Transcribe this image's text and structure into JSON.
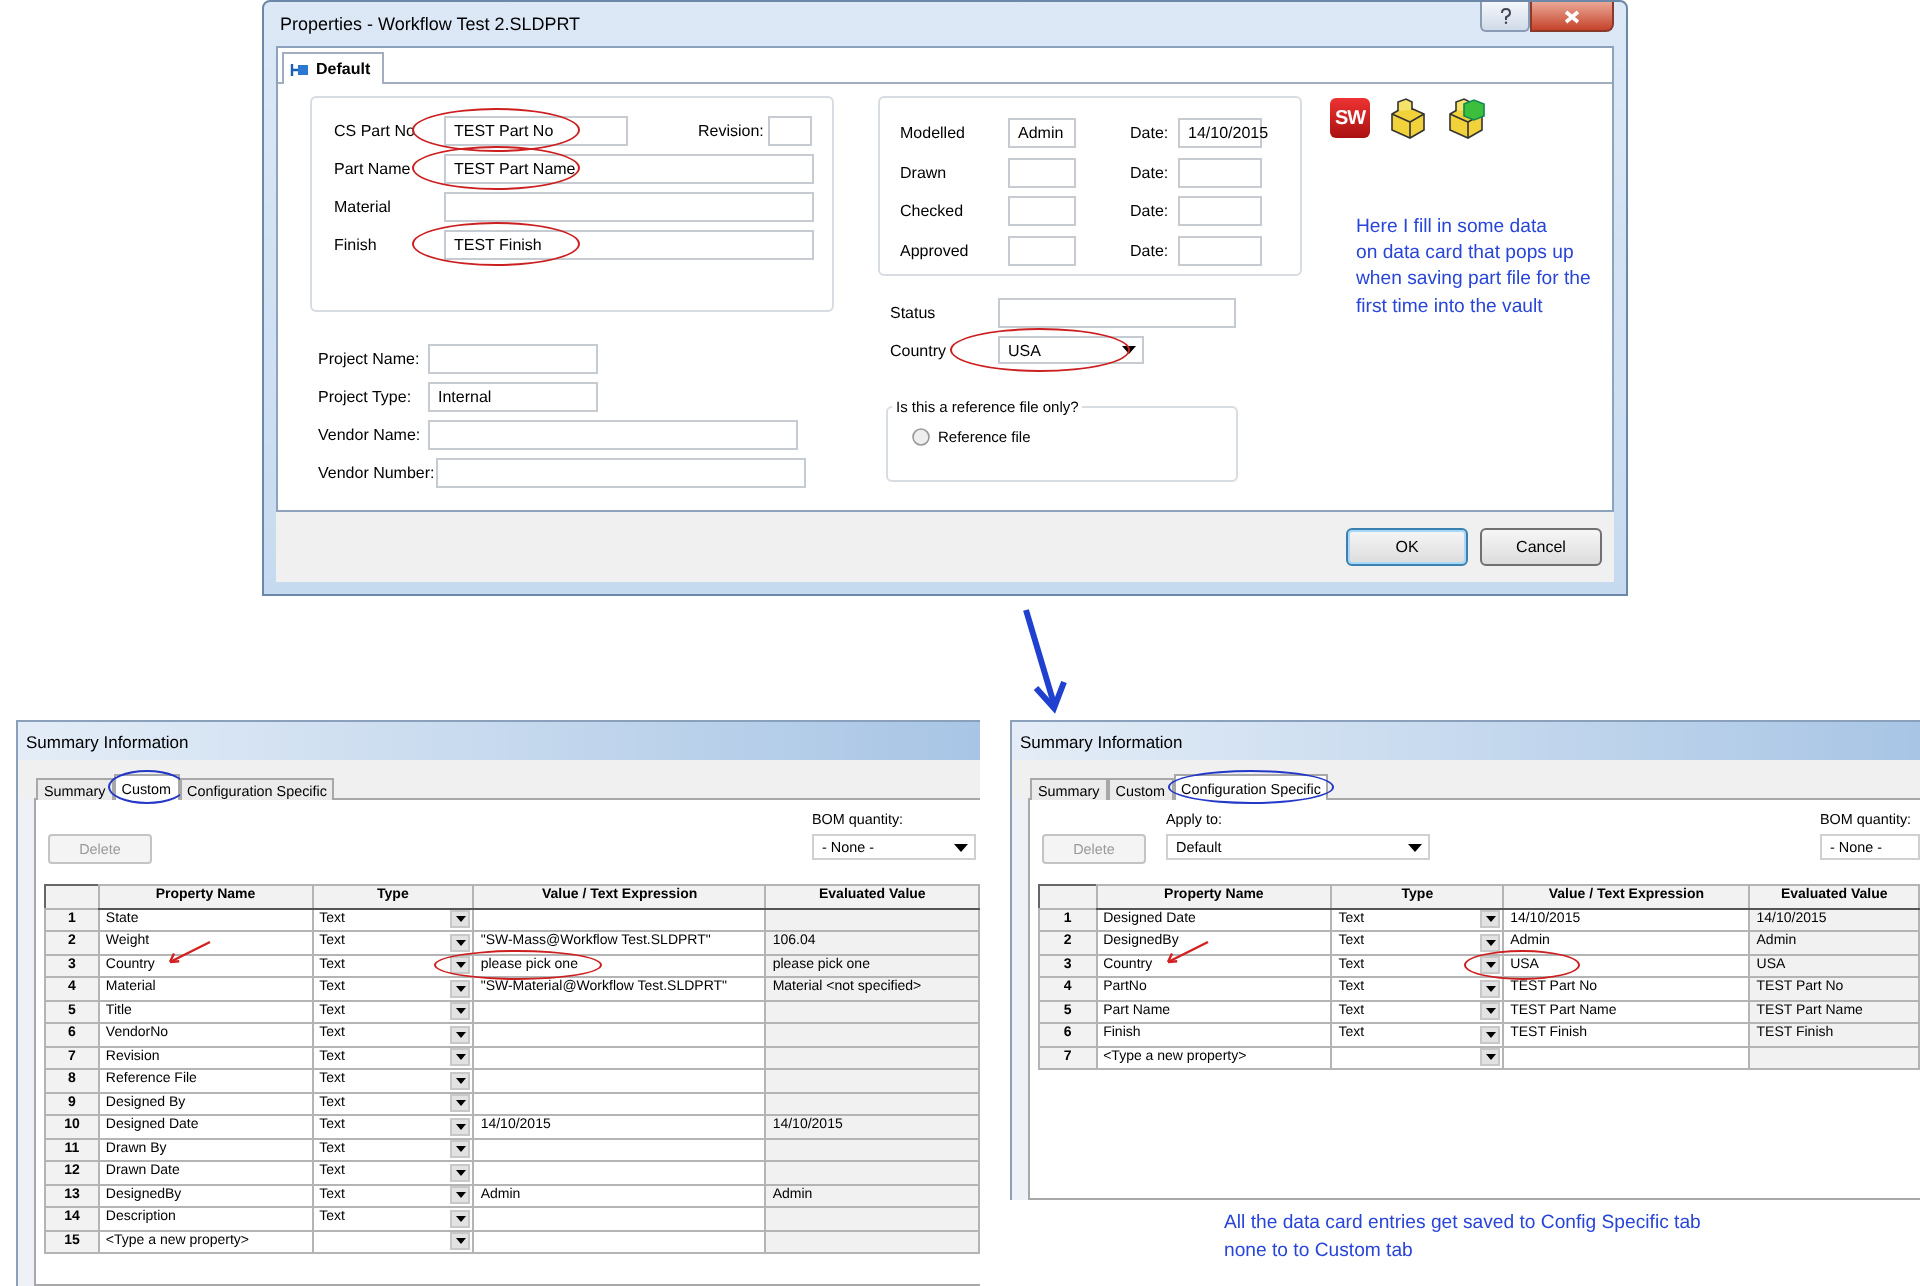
{
  "properties_dialog": {
    "title": "Properties - Workflow Test 2.SLDPRT",
    "tabs": [
      {
        "label": "Default",
        "selected": true
      }
    ],
    "part_fields": [
      {
        "label": "CS Part No",
        "value": "TEST Part No",
        "circled": true
      },
      {
        "label": "Part Name",
        "value": "TEST Part Name",
        "circled": true
      },
      {
        "label": "Material",
        "circled": false
      },
      {
        "label": "Finish",
        "value": "TEST Finish",
        "circled": true
      }
    ],
    "revision": {
      "label": "Revision:"
    },
    "project_fields": [
      {
        "label": "Project Name:"
      },
      {
        "label": "Project Type:",
        "value": "Internal"
      },
      {
        "label": "Vendor Name:"
      },
      {
        "label": "Vendor Number:"
      }
    ],
    "signoff_rows": [
      {
        "label": "Modelled",
        "name": "Admin",
        "date_label": "Date:",
        "date": "14/10/2015"
      },
      {
        "label": "Drawn",
        "date_label": "Date:"
      },
      {
        "label": "Checked",
        "date_label": "Date:"
      },
      {
        "label": "Approved",
        "date_label": "Date:"
      }
    ],
    "status": {
      "label": "Status"
    },
    "country": {
      "label": "Country",
      "value": "USA",
      "circled": true
    },
    "reference_group": {
      "legend": "Is this a reference file only?",
      "options": [
        {
          "label": "Reference file",
          "selected": false
        }
      ]
    },
    "logo_text": "SW",
    "note": {
      "lines": [
        "Here I fill in some data",
        "on data card that pops up",
        "when saving part file for the",
        "first time into the vault"
      ]
    },
    "buttons": [
      {
        "label": "OK",
        "default": true
      },
      {
        "label": "Cancel",
        "default": false
      }
    ]
  },
  "summary_windows": [
    {
      "title": "Summary Information",
      "tabs": [
        {
          "label": "Summary",
          "selected": false,
          "circled": false
        },
        {
          "label": "Custom",
          "selected": true,
          "circled": true
        },
        {
          "label": "Configuration Specific",
          "selected": false,
          "circled": false
        }
      ],
      "delete_button": {
        "label": "Delete",
        "disabled": true
      },
      "bom": {
        "label": "BOM quantity:",
        "value": "- None -"
      },
      "table": {
        "columns": [
          "Property Name",
          "Type",
          "Value / Text Expression",
          "Evaluated Value"
        ],
        "rows": [
          {
            "number": "1",
            "name": "State",
            "type": "Text",
            "highlighted": false
          },
          {
            "number": "2",
            "name": "Weight",
            "type": "Text",
            "value": "\"SW-Mass@Workflow Test.SLDPRT\"",
            "evaluated": "106.04",
            "highlighted": false
          },
          {
            "number": "3",
            "name": "Country",
            "type": "Text",
            "value": "please pick one",
            "evaluated": "please pick one",
            "highlighted": true
          },
          {
            "number": "4",
            "name": "Material",
            "type": "Text",
            "value": "\"SW-Material@Workflow Test.SLDPRT\"",
            "evaluated": "Material <not specified>",
            "highlighted": false
          },
          {
            "number": "5",
            "name": "Title",
            "type": "Text",
            "highlighted": false
          },
          {
            "number": "6",
            "name": "VendorNo",
            "type": "Text",
            "highlighted": false
          },
          {
            "number": "7",
            "name": "Revision",
            "type": "Text",
            "highlighted": false
          },
          {
            "number": "8",
            "name": "Reference File",
            "type": "Text",
            "highlighted": false
          },
          {
            "number": "9",
            "name": "Designed By",
            "type": "Text",
            "highlighted": false
          },
          {
            "number": "10",
            "name": "Designed Date",
            "type": "Text",
            "value": "14/10/2015",
            "evaluated": "14/10/2015",
            "highlighted": false
          },
          {
            "number": "11",
            "name": "Drawn By",
            "type": "Text",
            "highlighted": false
          },
          {
            "number": "12",
            "name": "Drawn Date",
            "type": "Text",
            "highlighted": false
          },
          {
            "number": "13",
            "name": "DesignedBy",
            "type": "Text",
            "value": "Admin",
            "evaluated": "Admin",
            "highlighted": false
          },
          {
            "number": "14",
            "name": "Description",
            "type": "Text",
            "highlighted": false
          },
          {
            "number": "15",
            "name": "<Type a new property>",
            "highlighted": false
          }
        ]
      }
    },
    {
      "title": "Summary Information",
      "tabs": [
        {
          "label": "Summary",
          "selected": false,
          "circled": false
        },
        {
          "label": "Custom",
          "selected": false,
          "circled": false
        },
        {
          "label": "Configuration Specific",
          "selected": true,
          "circled": true
        }
      ],
      "delete_button": {
        "label": "Delete",
        "disabled": true
      },
      "apply_to": {
        "label": "Apply to:",
        "value": "Default"
      },
      "bom": {
        "label": "BOM quantity:",
        "value": "- None -"
      },
      "table": {
        "columns": [
          "Property Name",
          "Type",
          "Value / Text Expression",
          "Evaluated Value"
        ],
        "rows": [
          {
            "number": "1",
            "name": "Designed Date",
            "type": "Text",
            "value": "14/10/2015",
            "evaluated": "14/10/2015",
            "highlighted": false
          },
          {
            "number": "2",
            "name": "DesignedBy",
            "type": "Text",
            "value": "Admin",
            "evaluated": "Admin",
            "highlighted": false
          },
          {
            "number": "3",
            "name": "Country",
            "type": "Text",
            "value": "USA",
            "evaluated": "USA",
            "highlighted": true
          },
          {
            "number": "4",
            "name": "PartNo",
            "type": "Text",
            "value": "TEST Part No",
            "evaluated": "TEST Part No",
            "highlighted": false
          },
          {
            "number": "5",
            "name": "Part Name",
            "type": "Text",
            "value": "TEST Part Name",
            "evaluated": "TEST Part Name",
            "highlighted": false
          },
          {
            "number": "6",
            "name": "Finish",
            "type": "Text",
            "value": "TEST Finish",
            "evaluated": "TEST Finish",
            "highlighted": false
          },
          {
            "number": "7",
            "name": "<Type a new property>",
            "highlighted": false
          }
        ]
      }
    }
  ],
  "bottom_note": {
    "lines": [
      "All the data card entries get saved to Config Specific tab",
      "none to to Custom tab"
    ]
  }
}
